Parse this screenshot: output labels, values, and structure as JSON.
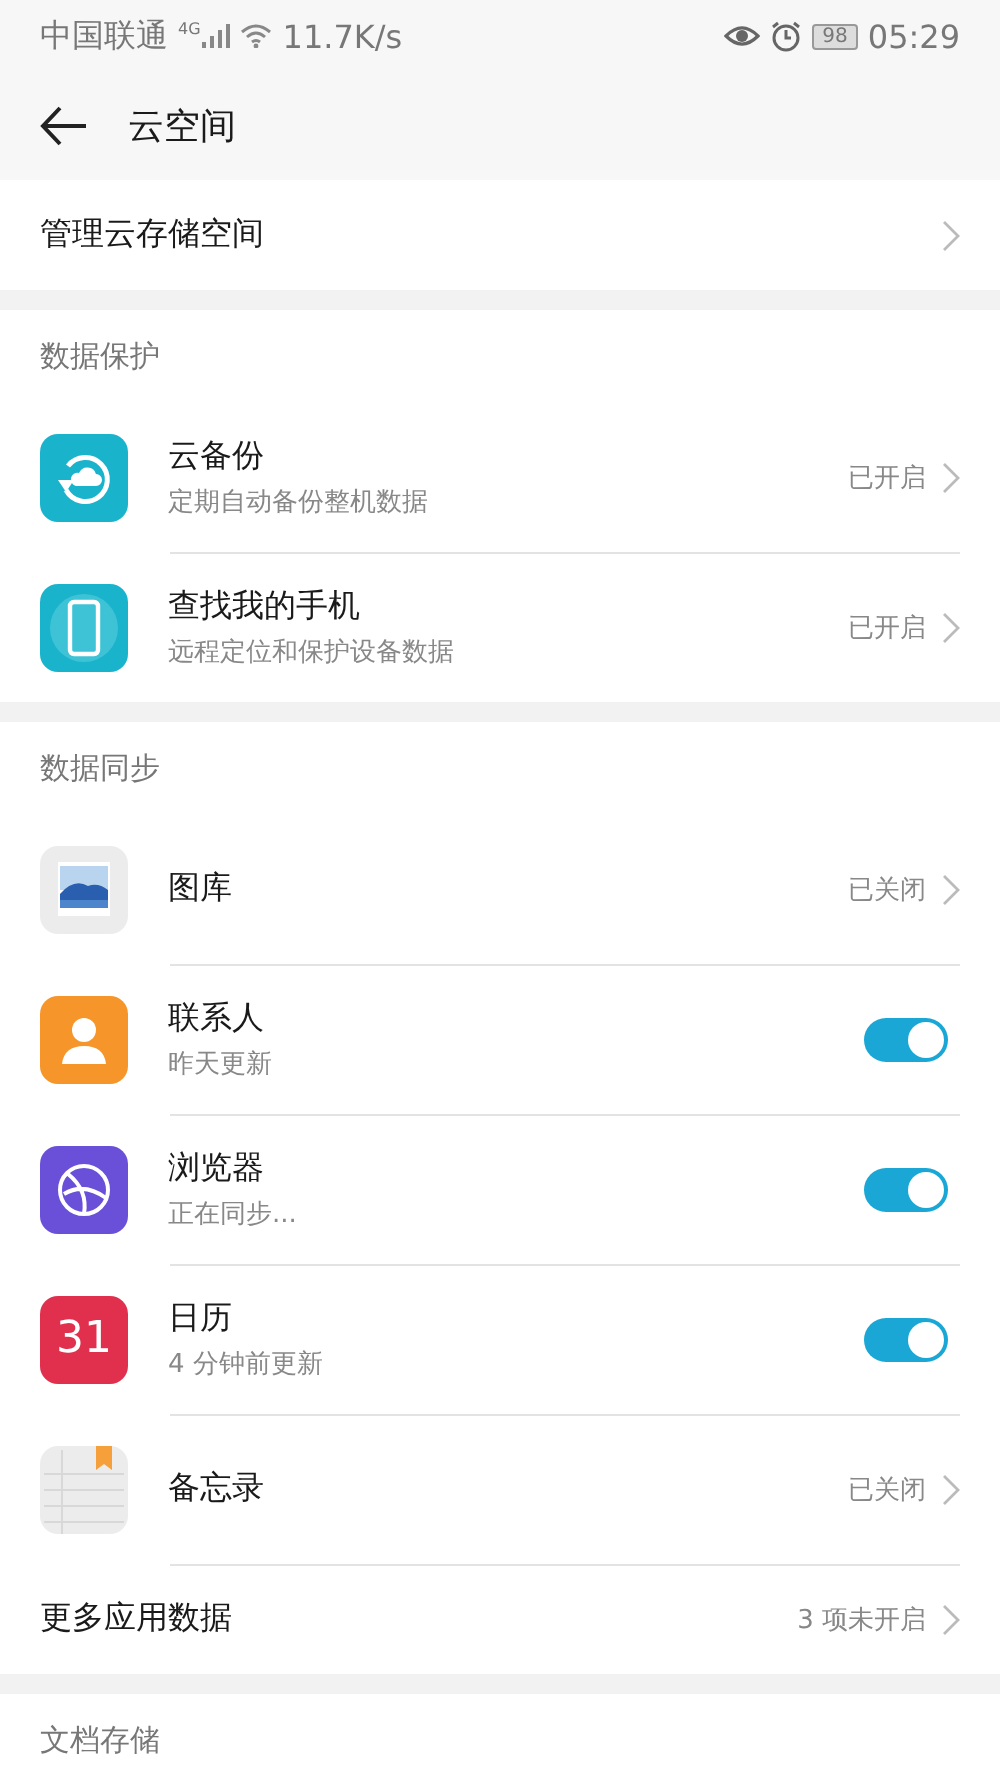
{
  "status_bar": {
    "carrier": "中国联通",
    "network": "4G",
    "speed": "11.7K/s",
    "battery": "98",
    "time": "05:29"
  },
  "header": {
    "title": "云空间"
  },
  "sections": [
    {
      "items": [
        {
          "kind": "link",
          "title": "管理云存储空间"
        }
      ]
    },
    {
      "heading": "数据保护",
      "items": [
        {
          "kind": "link",
          "title": "云备份",
          "subtitle": "定期自动备份整机数据",
          "status": "已开启"
        },
        {
          "kind": "link",
          "title": "查找我的手机",
          "subtitle": "远程定位和保护设备数据",
          "status": "已开启"
        }
      ]
    },
    {
      "heading": "数据同步",
      "items": [
        {
          "kind": "link",
          "title": "图库",
          "status": "已关闭"
        },
        {
          "kind": "toggle",
          "title": "联系人",
          "subtitle": "昨天更新",
          "on": true
        },
        {
          "kind": "toggle",
          "title": "浏览器",
          "subtitle": "正在同步...",
          "on": true
        },
        {
          "kind": "toggle",
          "icon_text": "31",
          "title": "日历",
          "subtitle": "4 分钟前更新",
          "on": true
        },
        {
          "kind": "link",
          "title": "备忘录",
          "status": "已关闭"
        },
        {
          "kind": "link",
          "title": "更多应用数据",
          "status": "3 项未开启"
        }
      ]
    },
    {
      "heading": "文档存储"
    }
  ]
}
